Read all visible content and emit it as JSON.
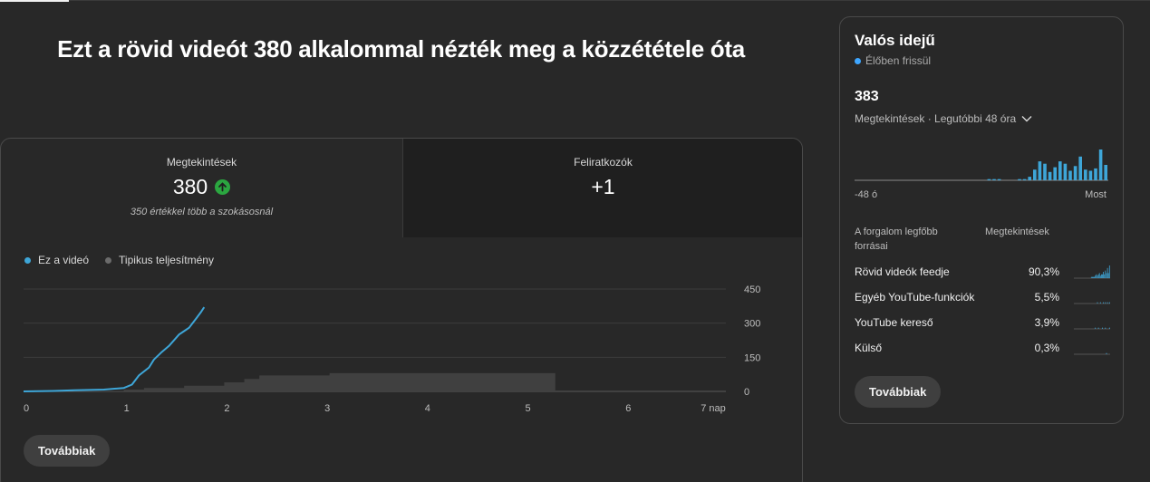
{
  "headline": "Ezt a rövid videót 380 alkalommal nézték meg a közzététele óta",
  "metrics": {
    "views": {
      "label": "Megtekintések",
      "value": "380",
      "note": "350 értékkel több a szokásosnál"
    },
    "subs": {
      "label": "Feliratkozók",
      "value": "+1"
    }
  },
  "legend": [
    {
      "label": "Ez a videó",
      "color": "#3ea6d8"
    },
    {
      "label": "Tipikus teljesítmény",
      "color": "#6b6b6b"
    }
  ],
  "chart_data": {
    "type": "line",
    "x_ticks": [
      "0",
      "1",
      "2",
      "3",
      "4",
      "5",
      "6",
      "7 nap"
    ],
    "y_ticks": [
      "0",
      "150",
      "300",
      "450"
    ],
    "ylim": [
      0,
      450
    ],
    "xlim": [
      0,
      7
    ],
    "series": [
      {
        "name": "Ez a videó",
        "x": [
          0,
          0.3,
          0.5,
          0.8,
          1.0,
          1.08,
          1.15,
          1.25,
          1.3,
          1.37,
          1.45,
          1.55,
          1.6,
          1.65,
          1.72,
          1.77,
          1.8
        ],
        "y": [
          0,
          2,
          5,
          8,
          15,
          30,
          70,
          105,
          140,
          170,
          200,
          250,
          265,
          280,
          320,
          350,
          370
        ]
      },
      {
        "name": "Tipikus teljesítmény",
        "x": [
          0,
          0.5,
          1.0,
          1.2,
          1.6,
          2.0,
          2.2,
          2.35,
          3.0,
          3.05,
          5.3
        ],
        "y": [
          0,
          2,
          8,
          15,
          25,
          40,
          55,
          70,
          70,
          80,
          80
        ]
      }
    ]
  },
  "more_button": "Továbbiak",
  "realtime": {
    "title": "Valós idejű",
    "live": "Élőben frissül",
    "count": "383",
    "period": "Megtekintések · Legutóbbi 48 óra",
    "axis_left": "-48 ó",
    "axis_right": "Most",
    "bars": [
      0,
      0,
      0,
      0,
      0,
      0,
      0,
      0,
      0,
      0,
      0,
      0,
      0,
      0,
      0,
      0,
      0,
      0,
      0,
      0,
      0,
      0,
      0,
      0,
      0,
      0,
      1,
      1,
      1,
      0,
      0,
      0,
      1,
      1,
      3,
      9,
      16,
      14,
      7,
      11,
      16,
      14,
      8,
      12,
      20,
      9,
      8,
      10,
      26,
      13
    ],
    "sources_header_left": "A forgalom legfőbb forrásai",
    "sources_header_right": "Megtekintések",
    "sources": [
      {
        "name": "Rövid videók feedje",
        "pct": "90,3%",
        "spark": [
          0,
          0,
          0,
          0,
          0,
          0,
          0,
          0,
          0,
          0,
          0,
          0,
          0,
          0,
          0,
          0,
          0,
          1,
          1,
          1,
          1,
          2,
          3,
          2,
          3,
          4,
          2,
          3,
          3,
          5,
          3,
          6,
          4,
          8,
          4,
          10
        ]
      },
      {
        "name": "Egyéb YouTube-funkciók",
        "pct": "5,5%",
        "spark": [
          0,
          0,
          0,
          0,
          0,
          0,
          0,
          0,
          0,
          0,
          0,
          0,
          0,
          0,
          0,
          0,
          0,
          0,
          0,
          0,
          0,
          0,
          0,
          1,
          0,
          0,
          1,
          0,
          0,
          1,
          0,
          1,
          0,
          1,
          0,
          1
        ]
      },
      {
        "name": "YouTube kereső",
        "pct": "3,9%",
        "spark": [
          0,
          0,
          0,
          0,
          0,
          0,
          0,
          0,
          0,
          0,
          0,
          0,
          0,
          0,
          0,
          0,
          0,
          0,
          0,
          0,
          0,
          1,
          0,
          0,
          1,
          0,
          0,
          0,
          1,
          0,
          0,
          1,
          0,
          0,
          0,
          1
        ]
      },
      {
        "name": "Külső",
        "pct": "0,3%",
        "spark": [
          0,
          0,
          0,
          0,
          0,
          0,
          0,
          0,
          0,
          0,
          0,
          0,
          0,
          0,
          0,
          0,
          0,
          0,
          0,
          0,
          0,
          0,
          0,
          0,
          0,
          0,
          0,
          0,
          0,
          0,
          0,
          0,
          1,
          0,
          0,
          0
        ]
      }
    ]
  }
}
